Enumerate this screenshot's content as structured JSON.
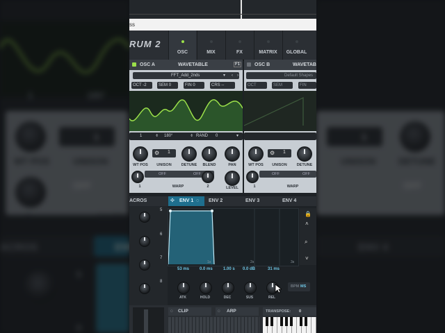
{
  "header": {
    "logo": "RUM 2",
    "tabs": [
      {
        "label": "OSC",
        "active": true
      },
      {
        "label": "MIX",
        "active": false
      },
      {
        "label": "FX",
        "active": false
      },
      {
        "label": "MATRIX",
        "active": false
      },
      {
        "label": "GLOBAL",
        "active": false
      }
    ]
  },
  "whitebar": {
    "text": "ss"
  },
  "osc_a": {
    "title": "OSC A",
    "type": "WAVETABLE",
    "table_name": "FFT_Add_2nds",
    "oct_label": "OCT",
    "oct_value": "-2",
    "sem_label": "SEM",
    "sem_value": "0",
    "fin_label": "FIN",
    "fin_value": "0",
    "crs_label": "CRS",
    "crs_value": "--",
    "frame": "1",
    "phase": "180°",
    "rand_label": "RAND",
    "rand_value": "0",
    "unison_value": "1",
    "knobs": [
      "WT POS",
      "UNISON",
      "DETUNE",
      "BLEND",
      "PAN"
    ],
    "warp_left": "OFF",
    "warp_right": "OFF",
    "warp_label": "WARP",
    "warp_1": "1",
    "warp_2": "2",
    "level": "LEVEL"
  },
  "osc_b": {
    "title": "OSC B",
    "type": "WAVETABLE",
    "table_name": "Default Shapes",
    "oct_label": "OCT",
    "sem_label": "SEM",
    "fin_label": "FIN",
    "unison_value": "1",
    "knobs": [
      "WT POS",
      "UNISON",
      "DETUNE"
    ],
    "warp_left": "OFF",
    "warp_right": "OFF",
    "warp_label": "WARP",
    "warp_1": "1"
  },
  "envs": {
    "macros": "ACROS",
    "tabs": [
      "ENV 1",
      "ENV 2",
      "ENV 3",
      "ENV 4"
    ],
    "macro_numbers": [
      "5",
      "6",
      "7",
      "8"
    ],
    "values": [
      "53 ms",
      "0.0 ms",
      "1.00 s",
      "0.0 dB",
      "31 ms"
    ],
    "knobs": [
      "ATK",
      "HOLD",
      "DEC",
      "SUS",
      "REL"
    ],
    "graph_ticks": [
      "1s",
      "2s",
      "3s"
    ],
    "bpm": "BPM",
    "ms": "MS"
  },
  "bottom": {
    "clip": "CLIP",
    "arp": "ARP",
    "transpose_label": "TRANSPOSE:",
    "transpose_value": "0"
  },
  "background": {
    "left_value_1": "1",
    "left_value_2": "180°",
    "left_knob_label": "WT POS",
    "left_unison": "UNISON",
    "left_unison_value": "1",
    "left_warp": "WARP",
    "left_warp_1": "1",
    "left_off": "OFF",
    "left_macros": "ACROS",
    "left_env": "ENV",
    "left_num_5": "5",
    "left_num_6": "6",
    "right_unison": "UNISON",
    "right_detune": "DETUNE",
    "right_unison_value": "1",
    "right_off": "OFF",
    "right_env4": "ENV 4"
  },
  "colors": {
    "accent": "#1f6f8e",
    "wave_green": "#9be04a",
    "env_fill": "#2a7f9b"
  }
}
